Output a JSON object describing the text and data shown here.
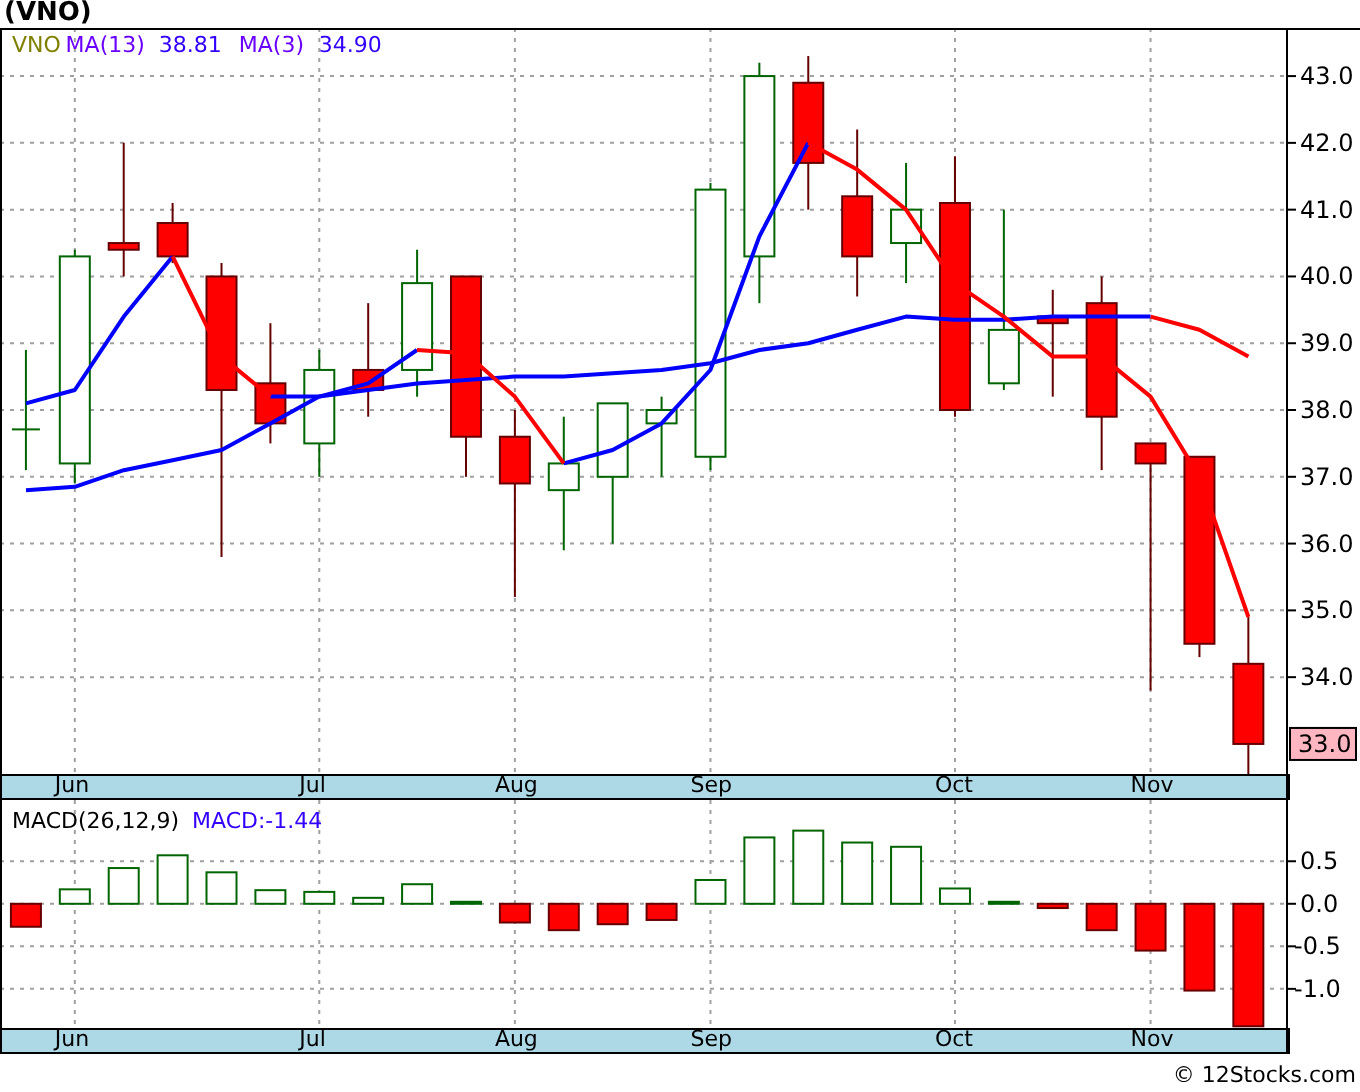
{
  "title": "(VNO)",
  "price_chart": {
    "legend": [
      {
        "text": "VNO",
        "color": "#808000"
      },
      {
        "text": "MA(13)",
        "color": "#6a00ff"
      },
      {
        "text": "38.81",
        "color": "#3300ff"
      },
      {
        "text": "MA(3)",
        "color": "#6a00ff"
      },
      {
        "text": "34.90",
        "color": "#3300ff"
      }
    ],
    "last_price": "33.0",
    "chart_data": {
      "type": "candlestick",
      "grid": true,
      "ylim": [
        32.55,
        43.72
      ],
      "yticks": [
        {
          "value": 34,
          "label": "34.0"
        },
        {
          "value": 35,
          "label": "35.0"
        },
        {
          "value": 36,
          "label": "36.0"
        },
        {
          "value": 37,
          "label": "37.0"
        },
        {
          "value": 38,
          "label": "38.0"
        },
        {
          "value": 39,
          "label": "39.0"
        },
        {
          "value": 40,
          "label": "40.0"
        },
        {
          "value": 41,
          "label": "41.0"
        },
        {
          "value": 42,
          "label": "42.0"
        },
        {
          "value": 43,
          "label": "43.0"
        }
      ],
      "categories": [
        null,
        "Jun",
        null,
        null,
        null,
        null,
        "Jul",
        null,
        null,
        null,
        "Aug",
        null,
        null,
        null,
        "Sep",
        null,
        null,
        null,
        null,
        "Oct",
        null,
        null,
        null,
        "Nov",
        null,
        null
      ],
      "ohlc": [
        [
          37.7,
          38.9,
          37.1,
          37.71
        ],
        [
          37.2,
          40.4,
          36.9,
          40.3
        ],
        [
          40.5,
          42.0,
          40.0,
          40.4
        ],
        [
          40.8,
          41.1,
          40.2,
          40.3
        ],
        [
          40.0,
          40.2,
          35.8,
          38.3
        ],
        [
          38.4,
          39.3,
          37.5,
          37.8
        ],
        [
          37.5,
          38.9,
          37.0,
          38.6
        ],
        [
          38.6,
          39.6,
          37.9,
          38.3
        ],
        [
          38.6,
          40.4,
          38.2,
          39.9
        ],
        [
          40.0,
          40.0,
          37.0,
          37.6
        ],
        [
          37.6,
          38.0,
          35.2,
          36.9
        ],
        [
          36.8,
          37.9,
          35.9,
          37.2
        ],
        [
          37.0,
          38.1,
          36.0,
          38.1
        ],
        [
          37.8,
          38.2,
          37.0,
          38.0
        ],
        [
          37.3,
          41.4,
          37.1,
          41.3
        ],
        [
          40.3,
          43.2,
          39.6,
          43.0
        ],
        [
          42.9,
          43.3,
          41.0,
          41.7
        ],
        [
          41.2,
          42.2,
          39.7,
          40.3
        ],
        [
          40.5,
          41.7,
          39.9,
          41.0
        ],
        [
          41.1,
          41.8,
          37.9,
          38.0
        ],
        [
          38.4,
          41.0,
          38.3,
          39.2
        ],
        [
          39.4,
          39.8,
          38.2,
          39.3
        ],
        [
          39.6,
          40.0,
          37.1,
          37.9
        ],
        [
          37.5,
          37.5,
          33.8,
          37.2
        ],
        [
          37.3,
          37.3,
          34.3,
          34.5
        ],
        [
          34.2,
          34.9,
          32.5,
          33.0
        ]
      ],
      "series": [
        {
          "type": "line",
          "color": "#0000ff",
          "values": [
            36.8,
            36.85,
            37.1,
            37.25,
            37.4,
            37.8,
            38.2,
            38.3,
            38.4,
            38.45,
            38.5,
            38.5,
            38.55,
            38.6,
            38.7,
            38.9,
            39.0,
            39.2,
            39.4,
            39.35,
            39.35,
            39.4,
            39.4,
            39.4,
            null,
            null
          ]
        },
        {
          "type": "line",
          "color": "#ff0000",
          "values": [
            null,
            null,
            null,
            null,
            null,
            null,
            null,
            null,
            null,
            null,
            null,
            null,
            null,
            null,
            null,
            null,
            null,
            null,
            null,
            null,
            null,
            null,
            null,
            39.4,
            39.2,
            38.8
          ]
        },
        {
          "type": "line",
          "color": "#0000ff",
          "values": [
            38.1,
            38.3,
            39.4,
            40.3,
            null,
            38.2,
            38.2,
            38.4,
            38.9,
            null,
            null,
            37.2,
            37.4,
            37.8,
            38.6,
            40.6,
            42.0,
            null,
            null,
            null,
            null,
            null,
            null,
            null,
            null,
            null
          ]
        },
        {
          "type": "line",
          "color": "#ff0000",
          "values": [
            null,
            null,
            null,
            40.3,
            38.8,
            38.2,
            null,
            null,
            38.9,
            38.85,
            38.2,
            37.2,
            null,
            null,
            null,
            null,
            42.0,
            41.6,
            41.0,
            39.9,
            39.4,
            38.8,
            38.8,
            38.2,
            37.0,
            34.9
          ]
        }
      ]
    }
  },
  "macd_chart": {
    "legend": [
      {
        "text": "MACD(26,12,9)",
        "color": "#000000"
      },
      {
        "text": "MACD:-1.44",
        "color": "#3300ff"
      }
    ],
    "chart_data": {
      "type": "bar",
      "grid": true,
      "ylim": [
        -1.46,
        1.22
      ],
      "yticks": [
        {
          "value": 0.5,
          "label": "0.5"
        },
        {
          "value": 0,
          "label": "0.0"
        },
        {
          "value": -0.5,
          "label": "-0.5"
        },
        {
          "value": -1,
          "label": "-1.0"
        }
      ],
      "categories": [
        null,
        "Jun",
        null,
        null,
        null,
        null,
        "Jul",
        null,
        null,
        null,
        "Aug",
        null,
        null,
        null,
        "Sep",
        null,
        null,
        null,
        null,
        "Oct",
        null,
        null,
        null,
        "Nov",
        null,
        null
      ],
      "values": [
        -0.27,
        0.17,
        0.42,
        0.57,
        0.37,
        0.16,
        0.14,
        0.07,
        0.23,
        0.02,
        -0.22,
        -0.31,
        -0.24,
        -0.19,
        0.28,
        0.78,
        0.86,
        0.72,
        0.67,
        0.18,
        0.02,
        -0.05,
        -0.31,
        -0.55,
        -1.02,
        -1.44
      ]
    }
  },
  "footer": "© 12Stocks.com"
}
